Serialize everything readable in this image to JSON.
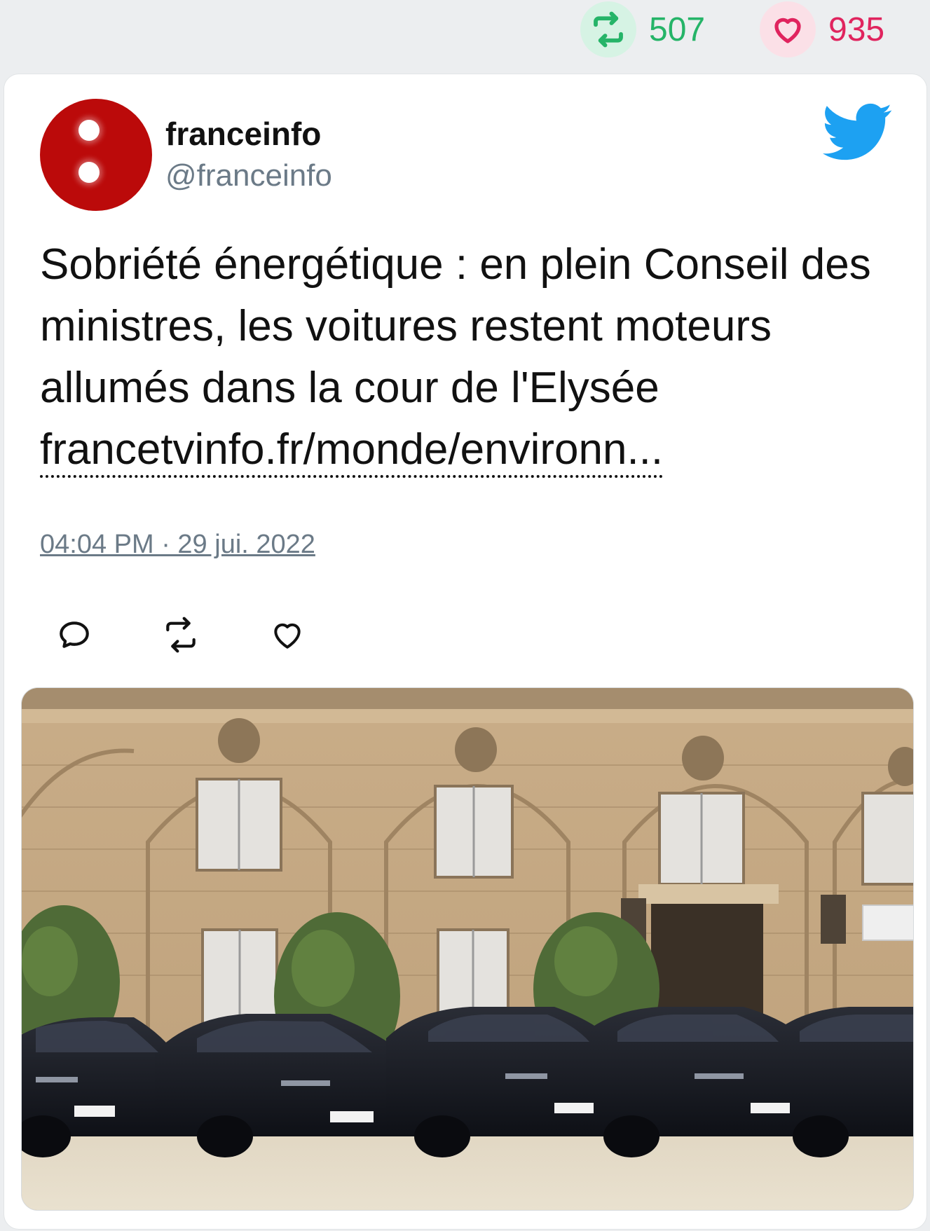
{
  "stats": {
    "retweet_icon": "retweet-icon",
    "retweet_count": "507",
    "like_icon": "heart-icon",
    "like_count": "935"
  },
  "tweet": {
    "author_name": "franceinfo",
    "author_handle": "@franceinfo",
    "text": "Sobriété énergétique : en plein Conseil des ministres, les voitures restent moteurs allumés dans la cour de l'Elysée",
    "link": "francetvinfo.fr/monde/environn...",
    "timestamp": "04:04 PM · 29 jui. 2022"
  },
  "actions": {
    "reply_icon": "reply-icon",
    "retweet_icon": "retweet-icon",
    "like_icon": "heart-icon"
  },
  "colors": {
    "retweet": "#25b468",
    "like": "#e0245e",
    "twitter_blue": "#1da1f2",
    "avatar_red": "#bb0a0a",
    "muted": "#6b7a87"
  }
}
